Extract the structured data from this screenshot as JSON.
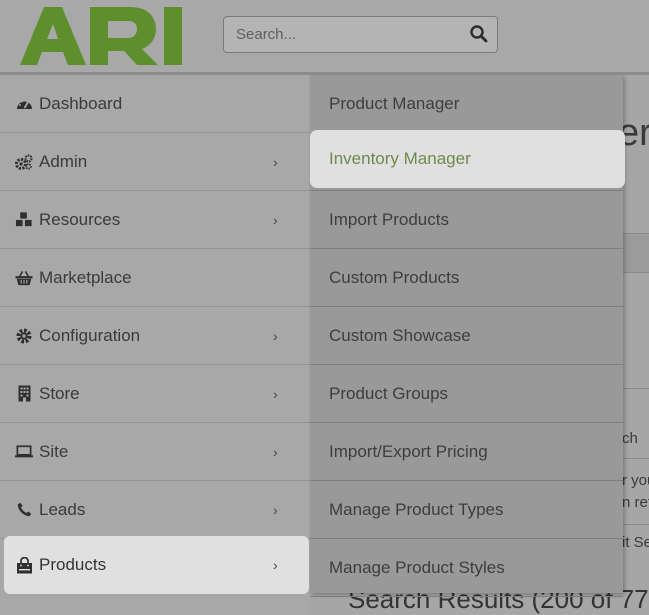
{
  "header": {
    "logo_text": "ARI",
    "logo_color": "#5f8f2c",
    "search_placeholder": "Search..."
  },
  "sidebar": {
    "items": [
      {
        "label": "Dashboard",
        "icon": "dashboard-gauge-icon",
        "has_chevron": false
      },
      {
        "label": "Admin",
        "icon": "cogs-icon",
        "has_chevron": true
      },
      {
        "label": "Resources",
        "icon": "cubes-icon",
        "has_chevron": true
      },
      {
        "label": "Marketplace",
        "icon": "basket-icon",
        "has_chevron": false
      },
      {
        "label": "Configuration",
        "icon": "gear-icon",
        "has_chevron": true
      },
      {
        "label": "Store",
        "icon": "building-icon",
        "has_chevron": true
      },
      {
        "label": "Site",
        "icon": "laptop-icon",
        "has_chevron": true
      },
      {
        "label": "Leads",
        "icon": "phone-icon",
        "has_chevron": true
      },
      {
        "label": "Products",
        "icon": "shopping-bag-icon",
        "has_chevron": true,
        "active": true
      }
    ],
    "chevron": "›"
  },
  "submenu": {
    "items": [
      {
        "label": "Product Manager"
      },
      {
        "label": "Inventory Manager",
        "highlighted": true
      },
      {
        "label": "Import Products"
      },
      {
        "label": "Custom Products"
      },
      {
        "label": "Custom Showcase"
      },
      {
        "label": "Product Groups"
      },
      {
        "label": "Import/Export Pricing"
      },
      {
        "label": "Manage Product Types"
      },
      {
        "label": "Manage Product Styles"
      }
    ],
    "highlight_color": "#6d8a4c"
  },
  "main_background": {
    "heading_fragment": "er",
    "fragment_1": "ch",
    "fragment_2": "r you",
    "fragment_3": "n ref",
    "fragment_4": "it Se",
    "search_results": "Search Results (200 of 77"
  }
}
